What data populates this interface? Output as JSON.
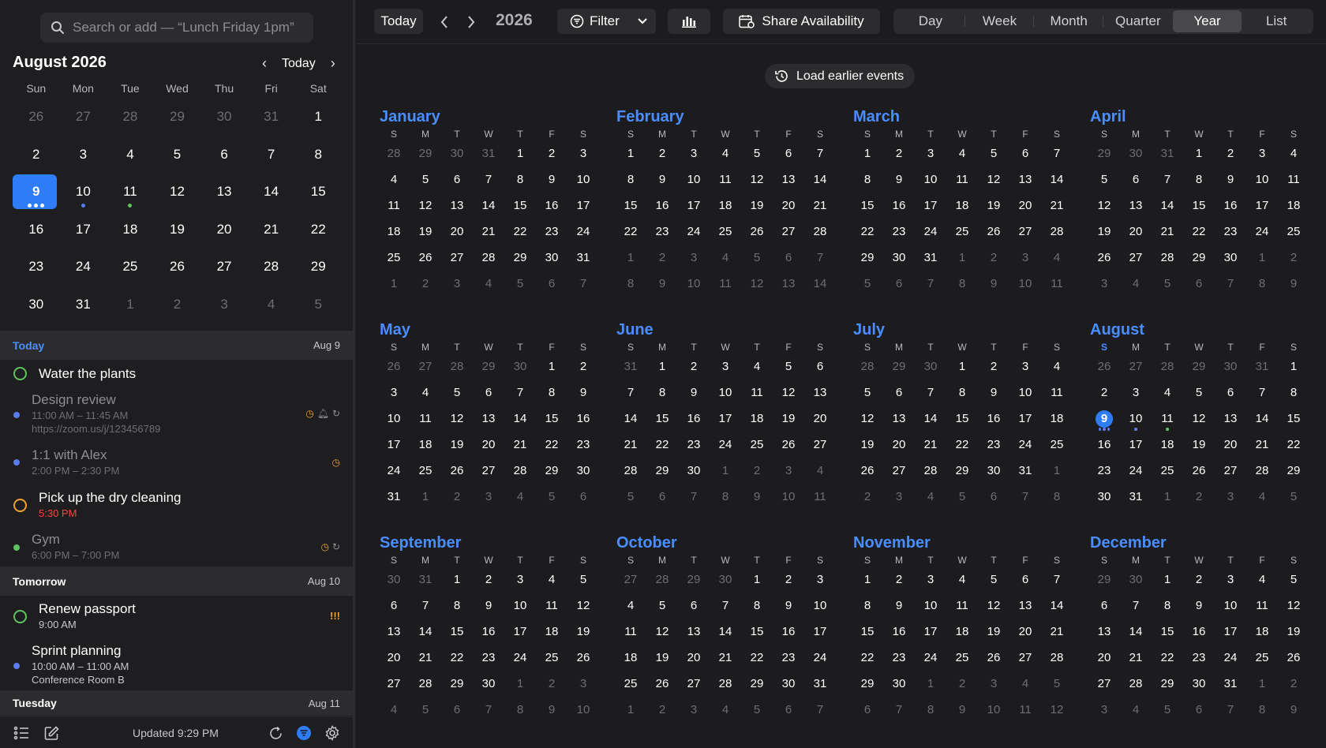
{
  "search": {
    "placeholder": "Search or add — “Lunch Friday 1pm”",
    "icon": "search-icon"
  },
  "mini": {
    "title": "August 2026",
    "today_label": "Today",
    "dow": [
      "Sun",
      "Mon",
      "Tue",
      "Wed",
      "Thu",
      "Fri",
      "Sat"
    ],
    "weeks": [
      [
        {
          "d": "26",
          "o": 1
        },
        {
          "d": "27",
          "o": 1
        },
        {
          "d": "28",
          "o": 1
        },
        {
          "d": "29",
          "o": 1
        },
        {
          "d": "30",
          "o": 1
        },
        {
          "d": "31",
          "o": 1
        },
        {
          "d": "1"
        }
      ],
      [
        {
          "d": "2"
        },
        {
          "d": "3"
        },
        {
          "d": "4"
        },
        {
          "d": "5"
        },
        {
          "d": "6"
        },
        {
          "d": "7"
        },
        {
          "d": "8"
        }
      ],
      [
        {
          "d": "9",
          "today": 1,
          "dots": [
            "#ffffff",
            "#ffffff",
            "#ffffff"
          ]
        },
        {
          "d": "10",
          "dots": [
            "#5b7cf0"
          ]
        },
        {
          "d": "11",
          "dots": [
            "#5fc35f"
          ]
        },
        {
          "d": "12"
        },
        {
          "d": "13"
        },
        {
          "d": "14"
        },
        {
          "d": "15"
        }
      ],
      [
        {
          "d": "16"
        },
        {
          "d": "17"
        },
        {
          "d": "18"
        },
        {
          "d": "19"
        },
        {
          "d": "20"
        },
        {
          "d": "21"
        },
        {
          "d": "22"
        }
      ],
      [
        {
          "d": "23"
        },
        {
          "d": "24"
        },
        {
          "d": "25"
        },
        {
          "d": "26"
        },
        {
          "d": "27"
        },
        {
          "d": "28"
        },
        {
          "d": "29"
        }
      ],
      [
        {
          "d": "30"
        },
        {
          "d": "31"
        },
        {
          "d": "1",
          "o": 1
        },
        {
          "d": "2",
          "o": 1
        },
        {
          "d": "3",
          "o": 1
        },
        {
          "d": "4",
          "o": 1
        },
        {
          "d": "5",
          "o": 1
        }
      ]
    ]
  },
  "agenda": {
    "today": {
      "label": "Today",
      "date": "Aug 9"
    },
    "tomorrow": {
      "label": "Tomorrow",
      "date": "Aug 10"
    },
    "tuesday": {
      "label": "Tuesday",
      "date": "Aug 11"
    },
    "items": {
      "water": {
        "title": "Water the plants",
        "color": "#5fc35f"
      },
      "design": {
        "title": "Design review",
        "time": "11:00 AM – 11:45 AM",
        "link": "https://zoom.us/j/123456789",
        "color": "#5b7cf0"
      },
      "alex": {
        "title": "1:1 with Alex",
        "time": "2:00 PM – 2:30 PM",
        "color": "#5b7cf0"
      },
      "dry": {
        "title": "Pick up the dry cleaning",
        "time": "5:30 PM",
        "color": "#f0a030",
        "time_color": "#ff453a"
      },
      "gym": {
        "title": "Gym",
        "time": "6:00 PM – 7:00 PM",
        "color": "#5fc35f"
      },
      "passport": {
        "title": "Renew passport",
        "time": "9:00 AM",
        "color": "#5fc35f",
        "priority": "!!!"
      },
      "sprint": {
        "title": "Sprint planning",
        "time": "10:00 AM – 11:00 AM",
        "location": "Conference Room B",
        "color": "#5b7cf0"
      }
    }
  },
  "bottom": {
    "updated": "Updated 9:29 PM"
  },
  "toolbar": {
    "today": "Today",
    "year": "2026",
    "filter": "Filter",
    "share": "Share Availability",
    "views": [
      "Day",
      "Week",
      "Month",
      "Quarter",
      "Year",
      "List"
    ],
    "active_view": "Year"
  },
  "load_earlier": "Load earlier events",
  "dow_short": [
    "S",
    "M",
    "T",
    "W",
    "T",
    "F",
    "S"
  ],
  "months": [
    {
      "name": "January",
      "start": 4,
      "days": 31,
      "prev": 31
    },
    {
      "name": "February",
      "start": 0,
      "days": 28,
      "prev": 31
    },
    {
      "name": "March",
      "start": 0,
      "days": 31,
      "prev": 28
    },
    {
      "name": "April",
      "start": 3,
      "days": 30,
      "prev": 31
    },
    {
      "name": "May",
      "start": 5,
      "days": 31,
      "prev": 30
    },
    {
      "name": "June",
      "start": 1,
      "days": 30,
      "prev": 31
    },
    {
      "name": "July",
      "start": 3,
      "days": 31,
      "prev": 30
    },
    {
      "name": "August",
      "start": 6,
      "days": 31,
      "prev": 31,
      "today": 9,
      "dots": {
        "9": [
          "#5b7cf0",
          "#5b7cf0",
          "#5b7cf0"
        ],
        "10": [
          "#5b7cf0"
        ],
        "11": [
          "#5fc35f"
        ]
      }
    },
    {
      "name": "September",
      "start": 2,
      "days": 30,
      "prev": 31
    },
    {
      "name": "October",
      "start": 4,
      "days": 31,
      "prev": 30
    },
    {
      "name": "November",
      "start": 0,
      "days": 30,
      "prev": 31
    },
    {
      "name": "December",
      "start": 2,
      "days": 31,
      "prev": 30
    }
  ],
  "colors": {
    "accent": "#2f7df6",
    "month_name": "#4a8dff",
    "today_header": "#4a90ff"
  }
}
